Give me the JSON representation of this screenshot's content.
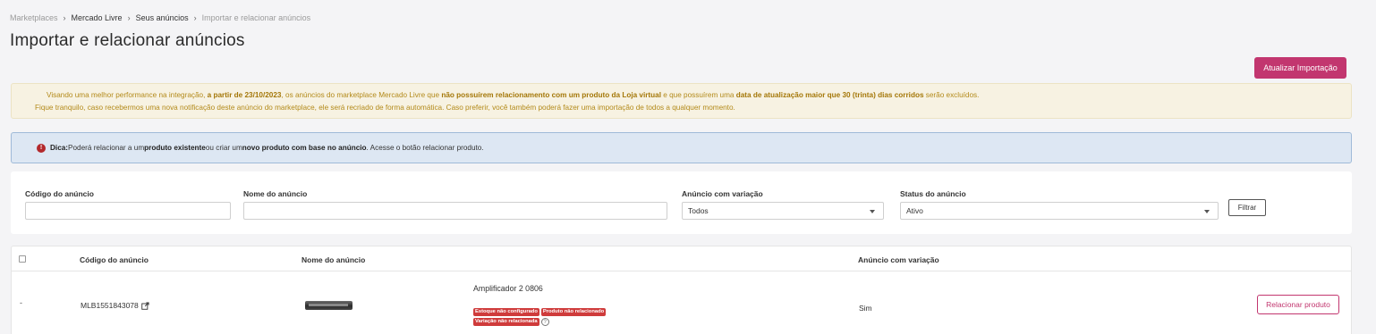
{
  "breadcrumb": {
    "items": [
      "Marketplaces",
      "Mercado Livre",
      "Seus anúncios",
      "Importar e relacionar anúncios"
    ],
    "separator": "›"
  },
  "page": {
    "title": "Importar e relacionar anúncios"
  },
  "actions": {
    "update_import": "Atualizar Importação"
  },
  "warning": {
    "line1": [
      "Visando uma melhor performance na integração, ",
      "a partir de 23/10/2023",
      ", os anúncios do marketplace Mercado Livre que ",
      "não possuírem relacionamento com um produto da Loja virtual",
      " e que possuírem uma ",
      "data de atualização maior que 30 (trinta) dias corridos",
      " serão excluídos."
    ],
    "line2": "Fique tranquilo, caso recebermos uma nova notificação deste anúncio do marketplace, ele será recriado de forma automática. Caso preferir, você também poderá fazer uma importação de todos a qualquer momento."
  },
  "tip": {
    "icon_glyph": "!",
    "parts": [
      "Dica:",
      " Poderá relacionar a um ",
      "produto existente",
      " ou criar um ",
      "novo produto com base no anúncio",
      ". Acesse o botão relacionar produto."
    ]
  },
  "filters": {
    "code_label": "Código do anúncio",
    "name_label": "Nome do anúncio",
    "variation_label": "Anúncio com variação",
    "variation_value": "Todos",
    "status_label": "Status do anúncio",
    "status_value": "Ativo",
    "filter_button": "Filtrar"
  },
  "table": {
    "headers": [
      "Código do anúncio",
      "Nome do anúncio",
      "Anúncio com variação"
    ],
    "rows": [
      {
        "dash": "-",
        "code": "MLB1551843078",
        "name": "Amplificador 2 0806",
        "badges": [
          "Estoque não configurado",
          "Produto não relacionado",
          "Variação não relacionada"
        ],
        "help_glyph": "?",
        "variation": "Sim",
        "action": "Relacionar produto"
      }
    ]
  },
  "colors": {
    "brand": "#c2366f",
    "danger": "#cf3b3b",
    "warning_text": "#b38a1a",
    "tip_bg": "#dde7f3"
  }
}
